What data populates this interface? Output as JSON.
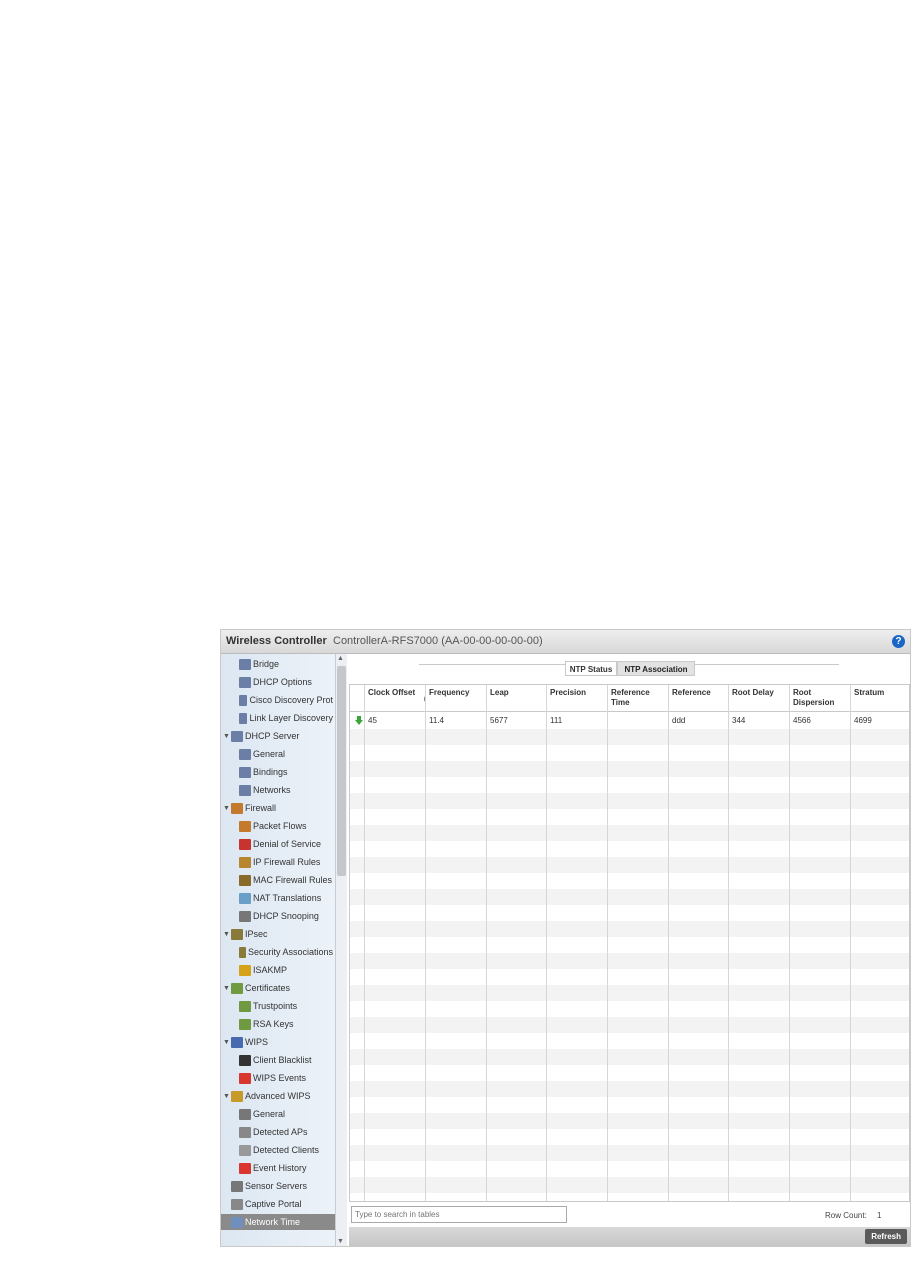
{
  "header": {
    "app_title": "Wireless Controller",
    "device": "ControllerA-RFS7000 (AA-00-00-00-00-00)",
    "help_icon": "?"
  },
  "sidebar": {
    "items": [
      {
        "label": "Bridge",
        "icon": "network-icon"
      },
      {
        "label": "DHCP Options",
        "icon": "network-icon"
      },
      {
        "label": "Cisco Discovery Prot",
        "icon": "network-icon"
      },
      {
        "label": "Link Layer Discovery",
        "icon": "network-icon"
      },
      {
        "label": "DHCP Server",
        "icon": "network-icon",
        "expanded": true
      },
      {
        "label": "General",
        "icon": "network-icon"
      },
      {
        "label": "Bindings",
        "icon": "network-icon"
      },
      {
        "label": "Networks",
        "icon": "network-icon"
      },
      {
        "label": "Firewall",
        "icon": "firewall-icon",
        "expanded": true
      },
      {
        "label": "Packet Flows",
        "icon": "firewall-icon"
      },
      {
        "label": "Denial of Service",
        "icon": "denial-icon"
      },
      {
        "label": "IP Firewall Rules",
        "icon": "ip-rules-icon"
      },
      {
        "label": "MAC Firewall Rules",
        "icon": "mac-rules-icon"
      },
      {
        "label": "NAT Translations",
        "icon": "nat-icon"
      },
      {
        "label": "DHCP Snooping",
        "icon": "snooping-icon"
      },
      {
        "label": "IPsec",
        "icon": "ipsec-icon",
        "expanded": true
      },
      {
        "label": "Security Associations",
        "icon": "ipsec-icon"
      },
      {
        "label": "ISAKMP",
        "icon": "key-icon"
      },
      {
        "label": "Certificates",
        "icon": "certificate-icon",
        "expanded": true
      },
      {
        "label": "Trustpoints",
        "icon": "certificate-icon"
      },
      {
        "label": "RSA Keys",
        "icon": "certificate-icon"
      },
      {
        "label": "WIPS",
        "icon": "wips-icon",
        "expanded": true
      },
      {
        "label": "Client Blacklist",
        "icon": "blacklist-icon"
      },
      {
        "label": "WIPS Events",
        "icon": "event-flag-icon"
      },
      {
        "label": "Advanced WIPS",
        "icon": "advanced-wips-icon",
        "expanded": true
      },
      {
        "label": "General",
        "icon": "general-icon"
      },
      {
        "label": "Detected APs",
        "icon": "ap-icon"
      },
      {
        "label": "Detected Clients",
        "icon": "client-icon"
      },
      {
        "label": "Event History",
        "icon": "event-flag-icon"
      },
      {
        "label": "Sensor Servers",
        "icon": "sensor-icon"
      },
      {
        "label": "Captive Portal",
        "icon": "portal-icon"
      },
      {
        "label": "Network Time",
        "icon": "network-time-icon",
        "selected": true
      }
    ]
  },
  "tabs": [
    {
      "label": "NTP Status",
      "active": false
    },
    {
      "label": "NTP Association",
      "active": true
    }
  ],
  "table": {
    "columns": [
      "Clock Offset",
      "Frequency",
      "Leap",
      "Precision",
      "Reference Time",
      "Reference",
      "Root Delay",
      "Root Dispersion",
      "Stratum"
    ],
    "rows": [
      [
        "45",
        "11.4",
        "5677",
        "111",
        "",
        "ddd",
        "344",
        "4566",
        "4699"
      ]
    ],
    "sort_icon": "sort-ascending-icon",
    "row_status_icon": "green-down-arrow-icon"
  },
  "footer": {
    "search_placeholder": "Type to search in tables",
    "row_count_label": "Row Count:",
    "row_count_value": "1",
    "refresh_label": "Refresh"
  },
  "colors": {
    "sidebar_bg": "#dce7f2",
    "selected_item": "#8a8a8a",
    "help_icon": "#1a66c8",
    "refresh_button": "#5a5a5a"
  }
}
